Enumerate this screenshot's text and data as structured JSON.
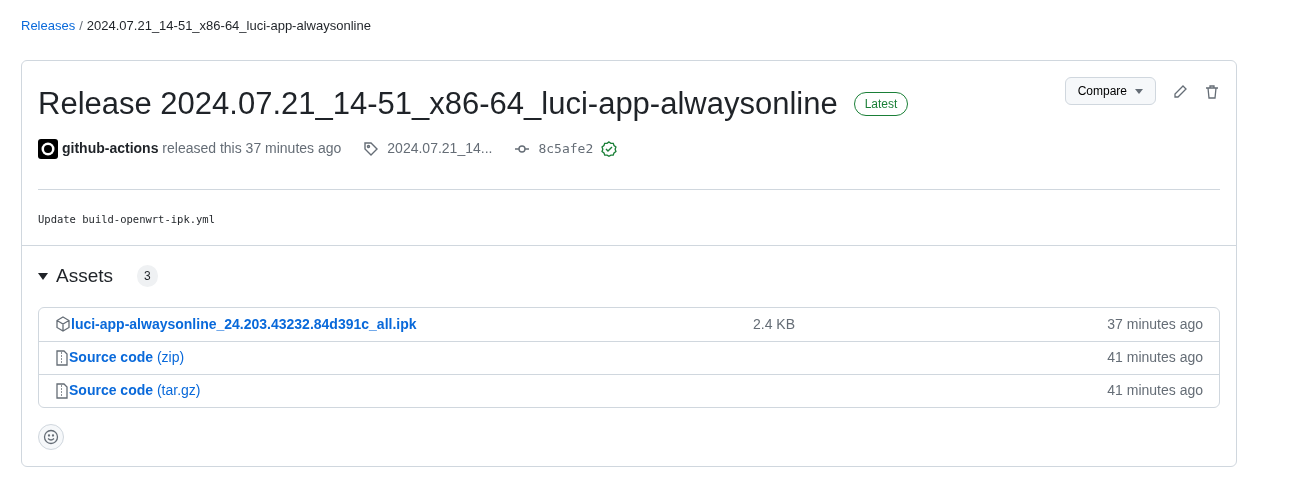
{
  "breadcrumb": {
    "link": "Releases",
    "separator": "/",
    "current": "2024.07.21_14-51_x86-64_luci-app-alwaysonline"
  },
  "release": {
    "title": "Release 2024.07.21_14-51_x86-64_luci-app-alwaysonline",
    "badge": "Latest",
    "compare_button": "Compare",
    "author": "github-actions",
    "released_text": "released this 37 minutes ago",
    "tag": "2024.07.21_14...",
    "commit": "8c5afe2",
    "message": "Update build-openwrt-ipk.yml"
  },
  "assets": {
    "title": "Assets",
    "count": "3",
    "expanded": true,
    "rows": [
      {
        "kind": "package",
        "name": "luci-app-alwaysonline_24.203.43232.84d391c_all.ipk",
        "size": "2.4 KB",
        "time": "37 minutes ago"
      },
      {
        "kind": "source",
        "name": "Source code",
        "suffix": "(zip)",
        "time": "41 minutes ago"
      },
      {
        "kind": "source",
        "name": "Source code",
        "suffix": "(tar.gz)",
        "time": "41 minutes ago"
      }
    ]
  }
}
